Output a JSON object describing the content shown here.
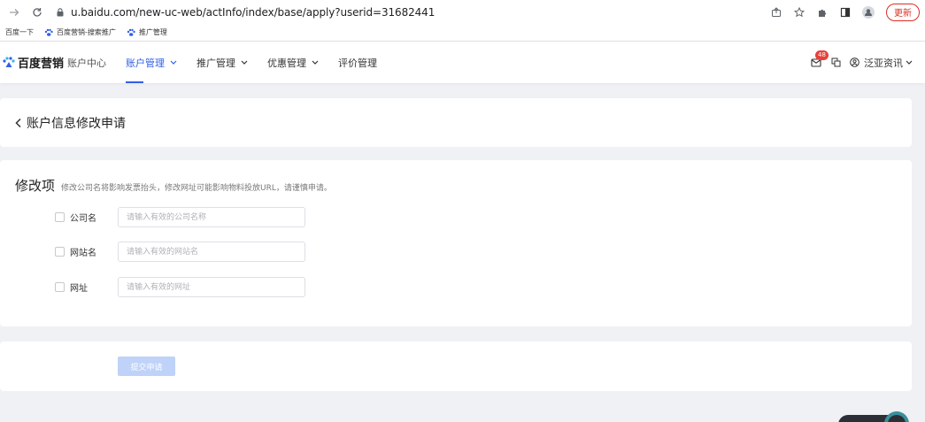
{
  "browser": {
    "url": "u.baidu.com/new-uc-web/actInfo/index/base/apply?userid=31682441",
    "update_label": "更新"
  },
  "bookmarks": [
    {
      "label": "百度一下"
    },
    {
      "label": "百度营销-搜索推广"
    },
    {
      "label": "推广管理"
    }
  ],
  "header": {
    "brand": "百度营销",
    "brand_sub": "账户中心",
    "nav": [
      {
        "label": "账户管理",
        "active": true
      },
      {
        "label": "推广管理"
      },
      {
        "label": "优惠管理"
      },
      {
        "label": "评价管理"
      }
    ],
    "badge_count": "48",
    "user_name": "泛亚资讯"
  },
  "page": {
    "title": "账户信息修改申请",
    "section_title": "修改项",
    "section_hint": "修改公司名将影响发票抬头，修改网址可能影响物料投放URL，请谨慎申请。",
    "fields": [
      {
        "label": "公司名",
        "placeholder": "请输入有效的公司名称",
        "value": ""
      },
      {
        "label": "网站名",
        "placeholder": "请输入有效的网站名",
        "value": ""
      },
      {
        "label": "网址",
        "placeholder": "请输入有效的网址",
        "value": ""
      }
    ],
    "submit_label": "提交申请"
  },
  "colors": {
    "accent": "#3160e3",
    "badge": "#e8403b",
    "submit_disabled": "#bfd2f8"
  }
}
